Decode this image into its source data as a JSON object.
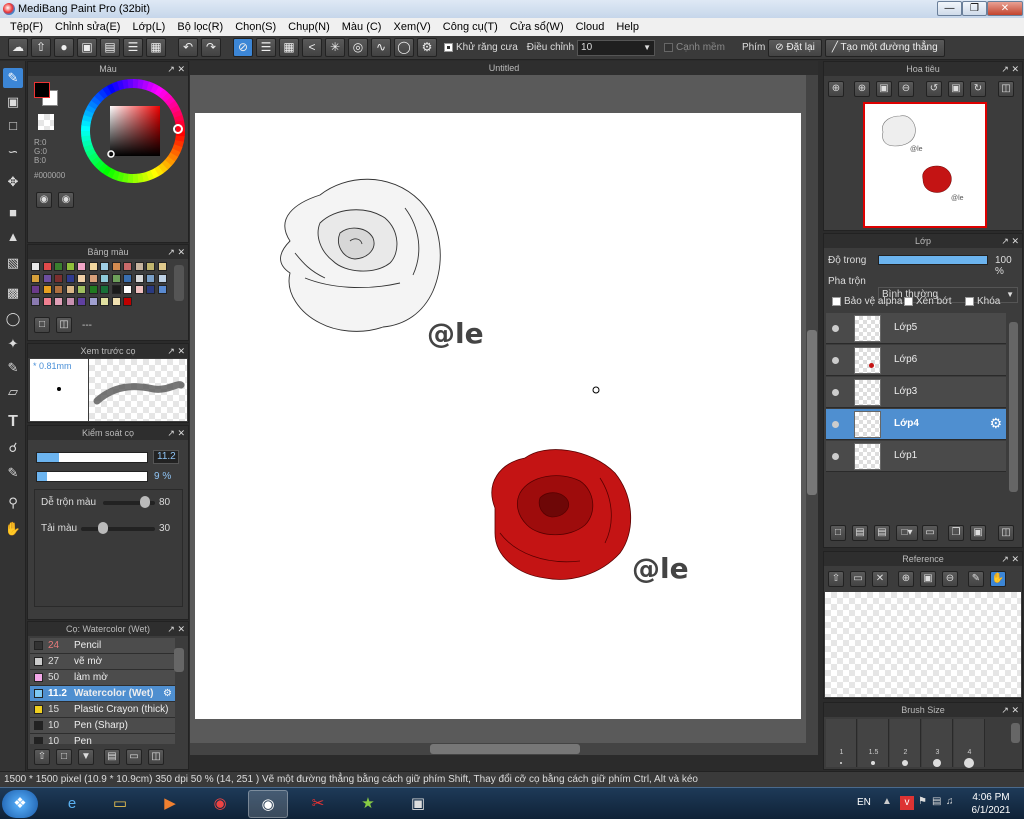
{
  "window": {
    "title": "MediBang Paint Pro (32bit)"
  },
  "menu": [
    "Tệp(F)",
    "Chỉnh sửa(E)",
    "Lớp(L)",
    "Bộ lọc(R)",
    "Chọn(S)",
    "Chụp(N)",
    "Màu (C)",
    "Xem(V)",
    "Công cụ(T)",
    "Cửa sổ(W)",
    "Cloud",
    "Help"
  ],
  "toolbar": {
    "antialias_label": "Khử răng cưa",
    "adjust_label": "Điều chỉnh",
    "adjust_value": "10",
    "smooth_label": "Cạnh mềm",
    "key_label": "Phím",
    "reset_label": "Đặt lại",
    "line_label": "Tạo một đường thẳng"
  },
  "color_panel": {
    "title": "Màu",
    "r": "R:0",
    "g": "G:0",
    "b": "B:0",
    "hex": "#000000"
  },
  "palette_panel": {
    "title": "Bảng màu",
    "footer": "---",
    "swatches": [
      "#e8e8e8",
      "#e24a4a",
      "#3a7f2f",
      "#8fbf3a",
      "#f2a6c8",
      "#f4d9a0",
      "#9fcfe6",
      "#d28b50",
      "#c96a6a",
      "#c7b49f",
      "#c2b66e",
      "#e0c98c",
      "#d6a03a",
      "#6d4fa0",
      "#7b2f2f",
      "#2f3a8f",
      "#f0d0a8",
      "#d9a07a",
      "#8ec9d8",
      "#6d9f5a",
      "#3a6fb0",
      "#d9d9d9",
      "#7aa0c8",
      "#bfd2e6",
      "#6a3a8a",
      "#e8a020",
      "#b07040",
      "#dbb889",
      "#a0c060",
      "#207a20",
      "#187038",
      "#1a1a1a",
      "#ffffff",
      "#f0c0c0",
      "#2a3a80",
      "#5a8ad0",
      "#8a7ab0",
      "#f08090",
      "#e0a0b8",
      "#c890b0",
      "#6040a0",
      "#a0a0d0",
      "#e0e0a0",
      "#f0e0b0",
      "#c00000"
    ]
  },
  "brush_preview_panel": {
    "title": "Xem trước cọ",
    "size": "* 0.81mm"
  },
  "brush_control_panel": {
    "title": "Kiểm soát cọ",
    "size_value": "11.2",
    "size_fraction": 0.2,
    "opacity_value": "9 %",
    "opacity_fraction": 0.09,
    "blend_label": "Dễ trộn màu",
    "blend_value": "80",
    "blend_fraction": 0.8,
    "refill_label": "Tải màu",
    "refill_value": "30",
    "refill_fraction": 0.3
  },
  "brush_list_panel": {
    "title": "Cọ: Watercolor (Wet)",
    "items": [
      {
        "size": "24",
        "name": "Pencil",
        "color": "#333333",
        "size_color": "#e87a7a"
      },
      {
        "size": "27",
        "name": "vẽ mờ",
        "color": "#cccccc",
        "size_color": "#dddddd"
      },
      {
        "size": "50",
        "name": "làm mờ",
        "color": "#f4a8e8",
        "size_color": "#dddddd"
      },
      {
        "size": "11.2",
        "name": "Watercolor (Wet)",
        "color": "#7ec8f4",
        "size_color": "#ffffff"
      },
      {
        "size": "15",
        "name": "Plastic Crayon (thick)",
        "color": "#f0d020",
        "size_color": "#dddddd"
      },
      {
        "size": "10",
        "name": "Pen (Sharp)",
        "color": "#222222",
        "size_color": "#dddddd"
      },
      {
        "size": "10",
        "name": "Pen",
        "color": "#222222",
        "size_color": "#dddddd"
      }
    ]
  },
  "canvas": {
    "tab": "Untitled",
    "signature1": "@le",
    "signature2": "@le"
  },
  "navigator_panel": {
    "title": "Hoa tiêu"
  },
  "layer_panel": {
    "title": "Lớp",
    "opacity_label": "Độ trong",
    "opacity_value": "100 %",
    "opacity_fraction": 1.0,
    "blend_label": "Pha trộn",
    "blend_value": "Bình thường",
    "protect_alpha": "Bảo vệ alpha",
    "clipping": "Xén bớt",
    "lock": "Khóa",
    "layers": [
      "Lớp5",
      "Lớp6",
      "Lớp3",
      "Lớp4",
      "Lớp1"
    ]
  },
  "reference_panel": {
    "title": "Reference"
  },
  "brush_size_panel": {
    "title": "Brush Size",
    "sizes": [
      "1",
      "1.5",
      "2",
      "3",
      "4"
    ]
  },
  "statusbar": {
    "text": "1500 * 1500 pixel  (10.9 * 10.9cm)  350 dpi  50 %  (14, 251 )  Vẽ một đường thẳng bằng cách giữ phím Shift, Thay đổi cỡ cọ bằng cách giữ phím Ctrl, Alt và kéo"
  },
  "taskbar": {
    "lang": "EN",
    "time": "4:06 PM",
    "date": "6/1/2021"
  }
}
